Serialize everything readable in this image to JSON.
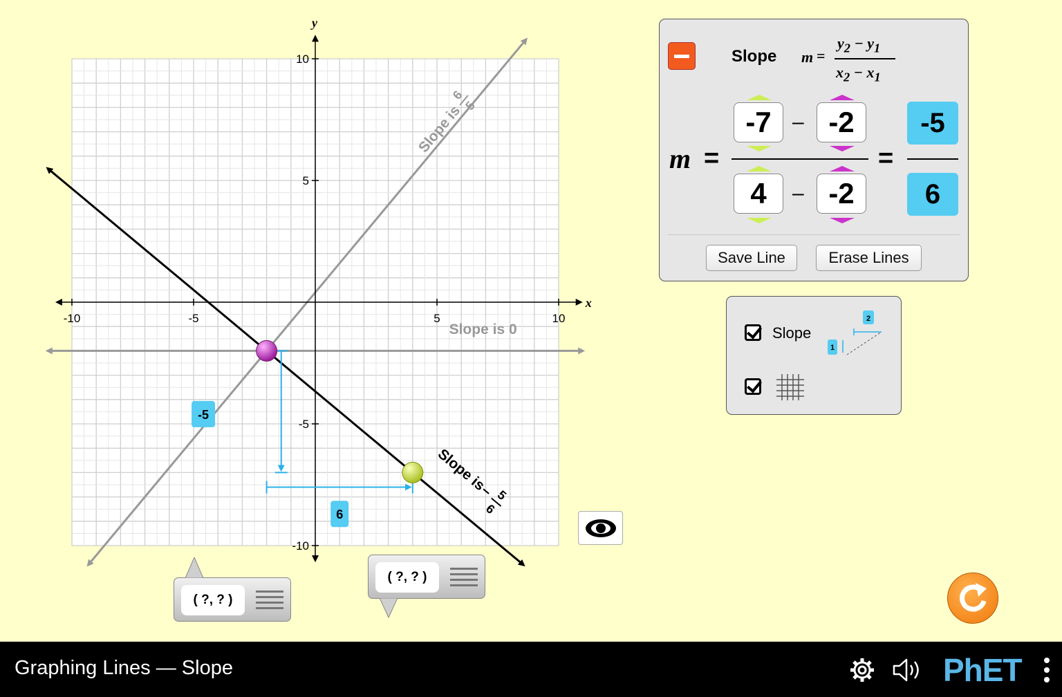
{
  "graph": {
    "x_axis_label": "x",
    "y_axis_label": "y",
    "tick_labels_x": [
      "-10",
      "-5",
      "5",
      "10"
    ],
    "tick_labels_y": [
      "10",
      "5",
      "-5",
      "-10"
    ],
    "x_range": [
      -10,
      10
    ],
    "y_range": [
      -10,
      10
    ],
    "saved_lines": [
      {
        "slope_prefix": "Slope is",
        "num": "6",
        "den": "5",
        "color": "#999999",
        "p1": [
          -2,
          -2
        ],
        "p2": [
          3,
          4
        ]
      },
      {
        "slope_prefix": "Slope is",
        "value": "0",
        "color": "#999999",
        "p1": [
          0,
          -2
        ],
        "p2": [
          1,
          -2
        ]
      }
    ],
    "current_line": {
      "slope_prefix": "Slope is",
      "sign": "–",
      "num": "5",
      "den": "6",
      "color": "#000000",
      "point1": {
        "x": -2,
        "y": -2,
        "color": "#cc33cc"
      },
      "point2": {
        "x": 4,
        "y": -7,
        "color": "#ccee33"
      }
    },
    "rise_label": "-5",
    "run_label": "6",
    "point_tools": [
      {
        "label": "( ?, ? )"
      },
      {
        "label": "( ?, ? )"
      }
    ]
  },
  "slope_panel": {
    "title": "Slope",
    "formula": {
      "m": "m",
      "eq": "=",
      "y2": "y",
      "y1": "y",
      "x2": "x",
      "x1": "x",
      "sub2": "2",
      "sub1": "1",
      "minus": "−"
    },
    "m_label": "m",
    "equals": "=",
    "minus": "–",
    "y2": "-7",
    "y1": "-2",
    "x2": "4",
    "x1": "-2",
    "result_num": "-5",
    "result_den": "6",
    "save_button": "Save Line",
    "erase_button": "Erase Lines",
    "accent_color": "#55ccf2"
  },
  "options_panel": {
    "slope_checkbox_label": "Slope",
    "slope_checked": true,
    "grid_checked": true,
    "slope_icon_run": "2",
    "slope_icon_rise": "1"
  },
  "bottom_bar": {
    "title": "Graphing Lines — Slope",
    "logo": "PhET"
  }
}
